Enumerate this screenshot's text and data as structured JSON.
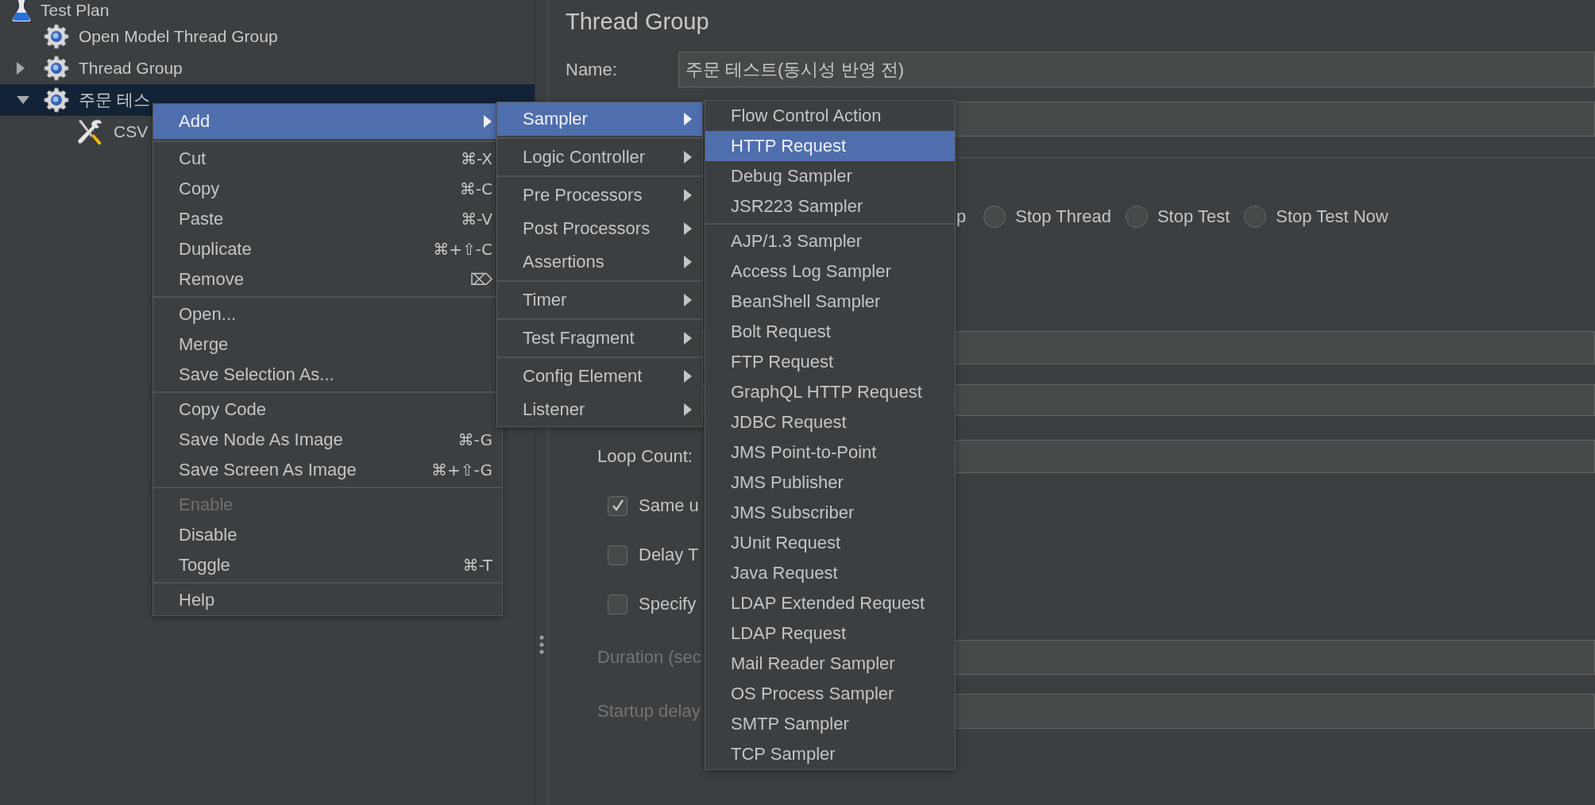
{
  "tree": {
    "items": [
      {
        "label": "Test Plan",
        "kind": "plan",
        "selected": false,
        "children": [
          {
            "label": "Open Model Thread Group",
            "kind": "group",
            "selected": false
          },
          {
            "label": "Thread Group",
            "kind": "group",
            "selected": false,
            "expanded": false
          },
          {
            "label": "주문 테스",
            "kind": "group",
            "selected": true,
            "expanded": true,
            "children": [
              {
                "label": "CSV",
                "kind": "config",
                "selected": false
              }
            ]
          }
        ]
      }
    ]
  },
  "context_menu": {
    "items": [
      {
        "kind": "submenu",
        "label": "Add",
        "selected": true,
        "disabled": false
      },
      {
        "kind": "separator"
      },
      {
        "kind": "item",
        "label": "Cut",
        "shortcut": "⌘-X",
        "selected": false,
        "disabled": false
      },
      {
        "kind": "item",
        "label": "Copy",
        "shortcut": "⌘-C",
        "selected": false,
        "disabled": false
      },
      {
        "kind": "item",
        "label": "Paste",
        "shortcut": "⌘-V",
        "selected": false,
        "disabled": false
      },
      {
        "kind": "item",
        "label": "Duplicate",
        "shortcut": "⌘+⇧-C",
        "selected": false,
        "disabled": false
      },
      {
        "kind": "item",
        "label": "Remove",
        "shortcut": "⌦",
        "selected": false,
        "disabled": false
      },
      {
        "kind": "separator"
      },
      {
        "kind": "item",
        "label": "Open...",
        "selected": false,
        "disabled": false
      },
      {
        "kind": "item",
        "label": "Merge",
        "selected": false,
        "disabled": false
      },
      {
        "kind": "item",
        "label": "Save Selection As...",
        "selected": false,
        "disabled": false
      },
      {
        "kind": "separator"
      },
      {
        "kind": "item",
        "label": "Copy Code",
        "selected": false,
        "disabled": false
      },
      {
        "kind": "item",
        "label": "Save Node As Image",
        "shortcut": "⌘-G",
        "selected": false,
        "disabled": false
      },
      {
        "kind": "item",
        "label": "Save Screen As Image",
        "shortcut": "⌘+⇧-G",
        "selected": false,
        "disabled": false
      },
      {
        "kind": "separator"
      },
      {
        "kind": "item",
        "label": "Enable",
        "selected": false,
        "disabled": true
      },
      {
        "kind": "item",
        "label": "Disable",
        "selected": false,
        "disabled": false
      },
      {
        "kind": "item",
        "label": "Toggle",
        "shortcut": "⌘-T",
        "selected": false,
        "disabled": false
      },
      {
        "kind": "separator"
      },
      {
        "kind": "item",
        "label": "Help",
        "selected": false,
        "disabled": false
      }
    ]
  },
  "add_menu": {
    "items": [
      {
        "kind": "submenu",
        "label": "Sampler",
        "selected": true
      },
      {
        "kind": "separator"
      },
      {
        "kind": "submenu",
        "label": "Logic Controller",
        "selected": false
      },
      {
        "kind": "separator"
      },
      {
        "kind": "submenu",
        "label": "Pre Processors",
        "selected": false
      },
      {
        "kind": "submenu",
        "label": "Post Processors",
        "selected": false
      },
      {
        "kind": "submenu",
        "label": "Assertions",
        "selected": false
      },
      {
        "kind": "separator"
      },
      {
        "kind": "submenu",
        "label": "Timer",
        "selected": false
      },
      {
        "kind": "separator"
      },
      {
        "kind": "submenu",
        "label": "Test Fragment",
        "selected": false
      },
      {
        "kind": "separator"
      },
      {
        "kind": "submenu",
        "label": "Config Element",
        "selected": false
      },
      {
        "kind": "submenu",
        "label": "Listener",
        "selected": false
      }
    ]
  },
  "sampler_menu": {
    "items": [
      {
        "kind": "item",
        "label": "Flow Control Action",
        "selected": false
      },
      {
        "kind": "item",
        "label": "HTTP Request",
        "selected": true
      },
      {
        "kind": "item",
        "label": "Debug Sampler",
        "selected": false
      },
      {
        "kind": "item",
        "label": "JSR223 Sampler",
        "selected": false
      },
      {
        "kind": "separator"
      },
      {
        "kind": "item",
        "label": "AJP/1.3 Sampler",
        "selected": false
      },
      {
        "kind": "item",
        "label": "Access Log Sampler",
        "selected": false
      },
      {
        "kind": "item",
        "label": "BeanShell Sampler",
        "selected": false
      },
      {
        "kind": "item",
        "label": "Bolt Request",
        "selected": false
      },
      {
        "kind": "item",
        "label": "FTP Request",
        "selected": false
      },
      {
        "kind": "item",
        "label": "GraphQL HTTP Request",
        "selected": false
      },
      {
        "kind": "item",
        "label": "JDBC Request",
        "selected": false
      },
      {
        "kind": "item",
        "label": "JMS Point-to-Point",
        "selected": false
      },
      {
        "kind": "item",
        "label": "JMS Publisher",
        "selected": false
      },
      {
        "kind": "item",
        "label": "JMS Subscriber",
        "selected": false
      },
      {
        "kind": "item",
        "label": "JUnit Request",
        "selected": false
      },
      {
        "kind": "item",
        "label": "Java Request",
        "selected": false
      },
      {
        "kind": "item",
        "label": "LDAP Extended Request",
        "selected": false
      },
      {
        "kind": "item",
        "label": "LDAP Request",
        "selected": false
      },
      {
        "kind": "item",
        "label": "Mail Reader Sampler",
        "selected": false
      },
      {
        "kind": "item",
        "label": "OS Process Sampler",
        "selected": false
      },
      {
        "kind": "item",
        "label": "SMTP Sampler",
        "selected": false
      },
      {
        "kind": "item",
        "label": "TCP Sampler",
        "selected": false
      }
    ]
  },
  "panel": {
    "title": "Thread Group",
    "name_label": "Name:",
    "name_value": "주문 테스트(동시성 반영 전)",
    "action_fragment": "p",
    "radios": [
      {
        "label": "Stop Thread",
        "selected": false
      },
      {
        "label": "Stop Test",
        "selected": false
      },
      {
        "label": "Stop Test Now",
        "selected": false
      }
    ],
    "loop_count_label": "Loop Count:",
    "checkboxes": [
      {
        "label": "Same u",
        "checked": true
      },
      {
        "label": "Delay T",
        "checked": false
      },
      {
        "label": "Specify",
        "checked": false
      }
    ],
    "timed_fields": [
      {
        "label": "Duration (sec",
        "disabled": true
      },
      {
        "label": "Startup delay",
        "disabled": true
      }
    ]
  }
}
